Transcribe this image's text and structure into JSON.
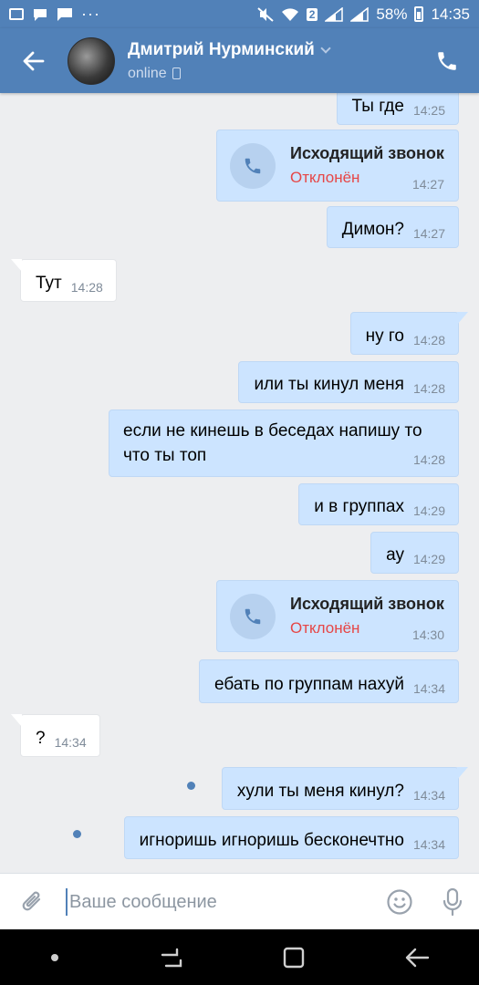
{
  "statusbar": {
    "sim_badge": "2",
    "battery": "58%",
    "time": "14:35"
  },
  "header": {
    "contact_name": "Дмитрий Нурминский",
    "status": "online"
  },
  "messages": [
    {
      "text": "Ты где",
      "time": "14:25"
    },
    {
      "call_title": "Исходящий звонок",
      "call_status": "Отклонён",
      "time": "14:27"
    },
    {
      "text": "Димон?",
      "time": "14:27"
    },
    {
      "text": "Тут",
      "time": "14:28"
    },
    {
      "text": "ну го",
      "time": "14:28"
    },
    {
      "text": "или ты кинул меня",
      "time": "14:28"
    },
    {
      "text_line1": "если не кинешь в беседах напишу то",
      "text_line2": "что ты топ",
      "time": "14:28"
    },
    {
      "text": "и в группах",
      "time": "14:29"
    },
    {
      "text": "ау",
      "time": "14:29"
    },
    {
      "call_title": "Исходящий звонок",
      "call_status": "Отклонён",
      "time": "14:30"
    },
    {
      "text": "ебать по группам нахуй",
      "time": "14:34"
    },
    {
      "text": "?",
      "time": "14:34"
    },
    {
      "text": "хули ты меня кинул?",
      "time": "14:34"
    },
    {
      "text": "игноришь игноришь бесконечтно",
      "time": "14:34"
    }
  ],
  "composer": {
    "placeholder": "Ваше сообщение"
  },
  "colors": {
    "brand": "#5181b8",
    "outgoing_bubble": "#cce4ff",
    "declined": "#e64646"
  }
}
